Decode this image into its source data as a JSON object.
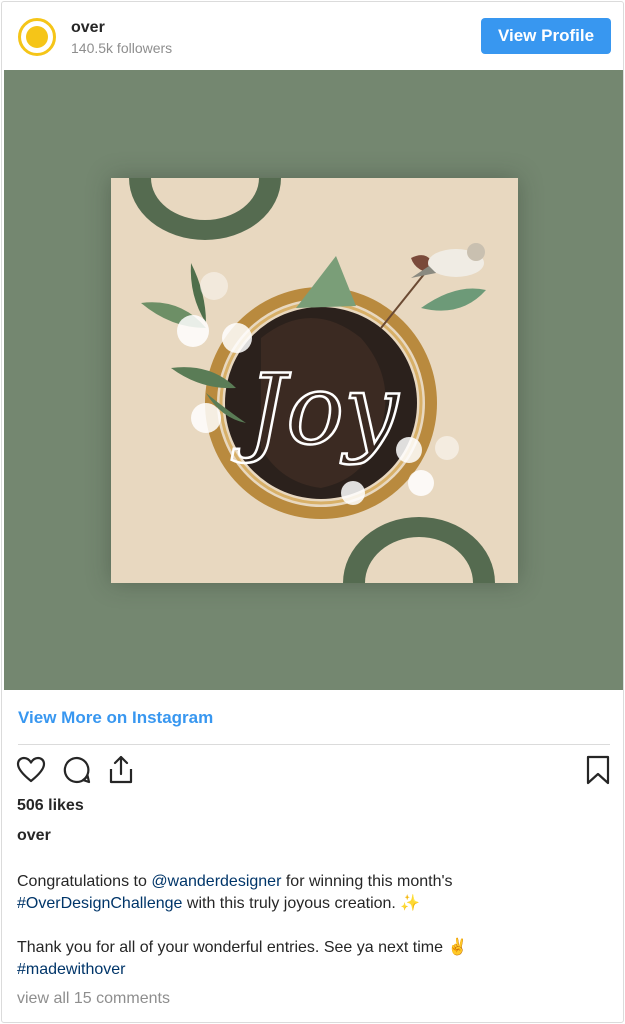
{
  "header": {
    "username": "over",
    "followers": "140.5k followers",
    "view_profile_label": "View Profile"
  },
  "media": {
    "artwork_text": "Joy",
    "background_color": "#748770",
    "artwork_color": "#e8d8c0",
    "accent_color": "#556b50"
  },
  "links": {
    "view_more": "View More on Instagram"
  },
  "actions": {
    "like_icon": "heart-icon",
    "comment_icon": "comment-icon",
    "share_icon": "share-icon",
    "save_icon": "bookmark-icon"
  },
  "post": {
    "likes": "506 likes",
    "caption_user": "over",
    "line1_prefix": "Congratulations to ",
    "mention": "@wanderdesigner",
    "line1_suffix": " for winning this month's",
    "hashtag1": "#OverDesignChallenge",
    "line2_suffix": " with this truly joyous creation. ✨",
    "line3": "Thank you for all of your wonderful entries. See ya next time ✌️",
    "hashtag2": "#madewithover",
    "comments_link": "view all 15 comments"
  },
  "colors": {
    "accent_blue": "#3897f0",
    "link_navy": "#003569",
    "muted": "#8e8e8e"
  }
}
